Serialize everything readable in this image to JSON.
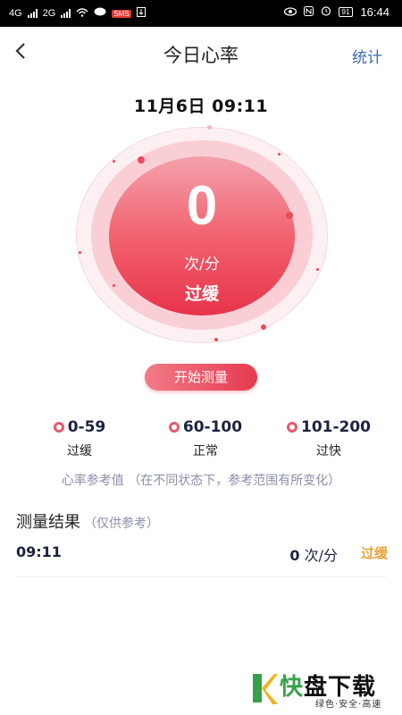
{
  "statusbar": {
    "net1": "4G",
    "net2": "2G",
    "badge": "SMS",
    "battery": "91",
    "time": "16:44"
  },
  "header": {
    "back_icon": "chevron-left-icon",
    "title": "今日心率",
    "stats_label": "统计"
  },
  "datetime": "11月6日 09:11",
  "gauge": {
    "value": "0",
    "unit": "次/分",
    "status": "过缓",
    "accent": "#e7334a"
  },
  "measure_button": "开始测量",
  "ranges": [
    {
      "range": "0-59",
      "label": "过缓"
    },
    {
      "range": "60-100",
      "label": "正常"
    },
    {
      "range": "101-200",
      "label": "过快"
    }
  ],
  "reference_note": "心率参考值 （在不同状态下，参考范围有所变化）",
  "results": {
    "title": "测量结果",
    "subtitle": "（仅供参考）",
    "rows": [
      {
        "time": "09:11",
        "value": "0",
        "unit": "次/分",
        "status": "过缓"
      }
    ]
  },
  "watermark": {
    "main_green": "快",
    "main_black": "盘下载",
    "sub": "绿色·安全·高速"
  }
}
